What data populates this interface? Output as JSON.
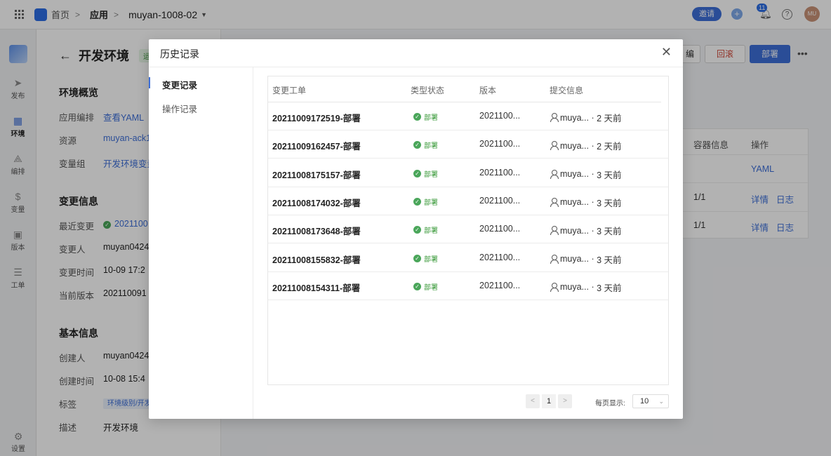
{
  "topbar": {
    "home": "首页",
    "app": "应用",
    "project": "muyan-1008-02",
    "invite": "邀请",
    "notification_count": "11",
    "avatar": "MU"
  },
  "sidebar": {
    "items": [
      {
        "label": "发布",
        "icon": "send-icon"
      },
      {
        "label": "环境",
        "icon": "grid-icon",
        "active": true
      },
      {
        "label": "编排",
        "icon": "shapes-icon"
      },
      {
        "label": "变量",
        "icon": "variable-icon"
      },
      {
        "label": "版本",
        "icon": "version-icon"
      },
      {
        "label": "工单",
        "icon": "ticket-icon"
      }
    ],
    "settings": "设置"
  },
  "page": {
    "title": "开发环境",
    "status": "运行",
    "overview_title": "环境概览",
    "overview": [
      {
        "label": "应用编排",
        "value": "查看YAML"
      },
      {
        "label": "资源",
        "value": "muyan-ack1"
      },
      {
        "label": "变量组",
        "value": "开发环境变量"
      }
    ],
    "change_title": "变更信息",
    "change": [
      {
        "label": "最近变更",
        "value": "2021100"
      },
      {
        "label": "变更人",
        "value": "muyan0424"
      },
      {
        "label": "变更时间",
        "value": "10-09 17:2"
      },
      {
        "label": "当前版本",
        "value": "202110091"
      }
    ],
    "basic_title": "基本信息",
    "basic": [
      {
        "label": "创建人",
        "value": "muyan0424"
      },
      {
        "label": "创建时间",
        "value": "10-08 15:4"
      },
      {
        "label": "标签",
        "value": "环境级别/开发"
      },
      {
        "label": "描述",
        "value": "开发环境"
      }
    ],
    "edit_partial": "编",
    "rollback": "回滚",
    "deploy": "部署",
    "table": {
      "col_container": "容器信息",
      "col_action": "操作",
      "yaml": "YAML",
      "rows": [
        {
          "container": "1/1",
          "detail": "详情",
          "log": "日志"
        },
        {
          "container": "1/1",
          "detail": "详情",
          "log": "日志"
        }
      ]
    }
  },
  "modal": {
    "title": "历史记录",
    "tabs": [
      "变更记录",
      "操作记录"
    ],
    "columns": [
      "变更工单",
      "类型状态",
      "版本",
      "提交信息"
    ],
    "records": [
      {
        "order": "20211009172519-部署",
        "status": "部署",
        "version": "2021100...",
        "user": "muya...",
        "time": "2 天前"
      },
      {
        "order": "20211009162457-部署",
        "status": "部署",
        "version": "2021100...",
        "user": "muya...",
        "time": "2 天前"
      },
      {
        "order": "20211008175157-部署",
        "status": "部署",
        "version": "2021100...",
        "user": "muya...",
        "time": "3 天前"
      },
      {
        "order": "20211008174032-部署",
        "status": "部署",
        "version": "2021100...",
        "user": "muya...",
        "time": "3 天前"
      },
      {
        "order": "20211008173648-部署",
        "status": "部署",
        "version": "2021100...",
        "user": "muya...",
        "time": "3 天前"
      },
      {
        "order": "20211008155832-部署",
        "status": "部署",
        "version": "2021100...",
        "user": "muya...",
        "time": "3 天前"
      },
      {
        "order": "20211008154311-部署",
        "status": "部署",
        "version": "2021100...",
        "user": "muya...",
        "time": "3 天前"
      }
    ],
    "page": "1",
    "per_page_label": "每页显示:",
    "per_page": "10"
  },
  "colors": {
    "accent": "#3d6fd8",
    "success": "#4aa65a",
    "danger": "#d14a3b"
  }
}
